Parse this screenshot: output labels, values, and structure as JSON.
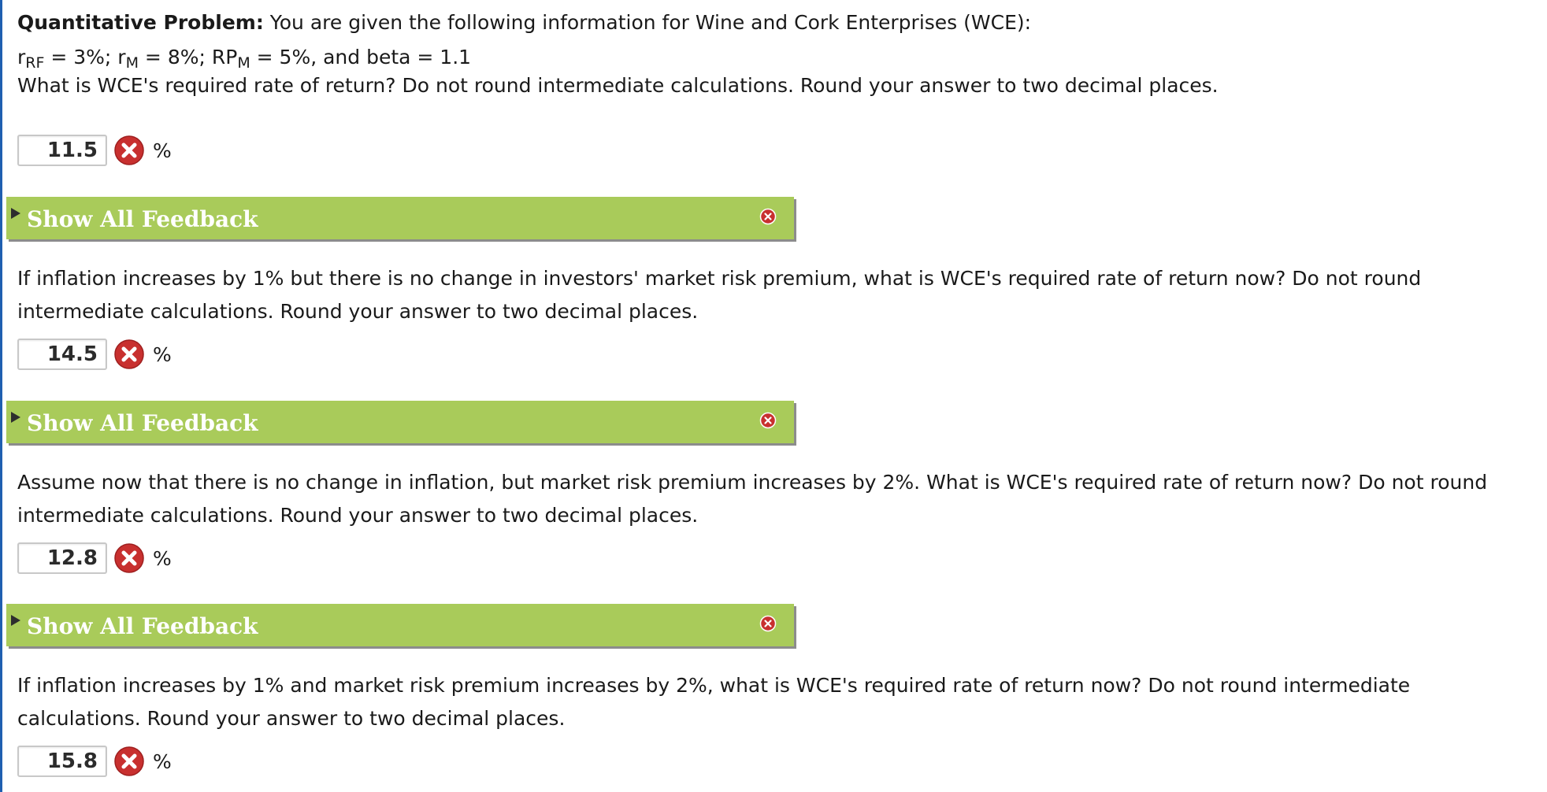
{
  "intro": {
    "label": "Quantitative Problem:",
    "text": " You are given the following information for Wine and Cork Enterprises (WCE):"
  },
  "givens": {
    "rrf_symbol": "r",
    "rrf_sub": "RF",
    "rrf_value": " = 3%; ",
    "rm_symbol": "r",
    "rm_sub": "M",
    "rm_value": " = 8%; ",
    "rpm_symbol": "RP",
    "rpm_sub": "M",
    "rpm_value": " = 5%, and beta = 1.1"
  },
  "questions": [
    {
      "text": "What is WCE's required rate of return? Do not round intermediate calculations. Round your answer to two decimal places.",
      "answer": "11.5",
      "unit": "%"
    },
    {
      "text": "If inflation increases by 1% but there is no change in investors' market risk premium, what is WCE's required rate of return now? Do not round intermediate calculations. Round your answer to two decimal places.",
      "answer": "14.5",
      "unit": "%"
    },
    {
      "text": "Assume now that there is no change in inflation, but market risk premium increases by 2%. What is WCE's required rate of return now? Do not round intermediate calculations. Round your answer to two decimal places.",
      "answer": "12.8",
      "unit": "%"
    },
    {
      "text": "If inflation increases by 1% and market risk premium increases by 2%, what is WCE's required rate of return now? Do not round intermediate calculations. Round your answer to two decimal places.",
      "answer": "15.8",
      "unit": "%"
    }
  ],
  "feedback": {
    "label": "Show All Feedback"
  },
  "colors": {
    "feedback_bar": "#a9cb5a",
    "wrong_icon": "#c8302f",
    "left_rule": "#1f5fb0"
  }
}
